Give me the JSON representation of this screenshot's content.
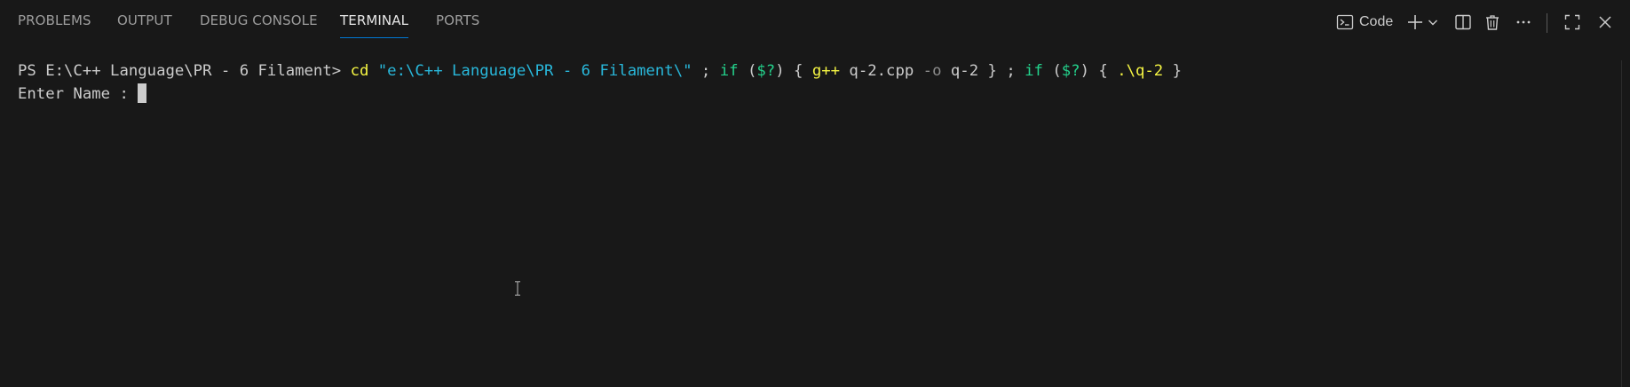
{
  "tabs": [
    {
      "label": "PROBLEMS",
      "active": false
    },
    {
      "label": "OUTPUT",
      "active": false
    },
    {
      "label": "DEBUG CONSOLE",
      "active": false
    },
    {
      "label": "TERMINAL",
      "active": true
    },
    {
      "label": "PORTS",
      "active": false
    }
  ],
  "toolbar": {
    "terminal_name": "Code",
    "icons": [
      "terminal-icon",
      "add-icon",
      "chevron-down-icon",
      "split-icon",
      "trash-icon",
      "more-icon",
      "maximize-icon",
      "close-icon"
    ]
  },
  "terminal": {
    "line1": {
      "prompt": "PS E:\\C++ Language\\PR - 6 Filament> ",
      "cd": "cd",
      "sp1": " ",
      "path": "\"e:\\C++ Language\\PR - 6 Filament\\\"",
      "sep1": " ; ",
      "if1": "if",
      "sp2": " (",
      "var1": "$?",
      "close1": ") { ",
      "gpp": "g++",
      "file": " q-2.cpp ",
      "flag": "-o",
      "out": " q-2 } ; ",
      "if2": "if",
      "sp3": " (",
      "var2": "$?",
      "close2": ") { ",
      "exe": ".\\q-2",
      "end": " }"
    },
    "line2": "Enter Name : "
  },
  "colors": {
    "background": "#181818",
    "active_tab_underline": "#0078d4",
    "command_yellow": "#f5f543",
    "string_cyan": "#29b8db",
    "keyword_green": "#23d18b"
  }
}
